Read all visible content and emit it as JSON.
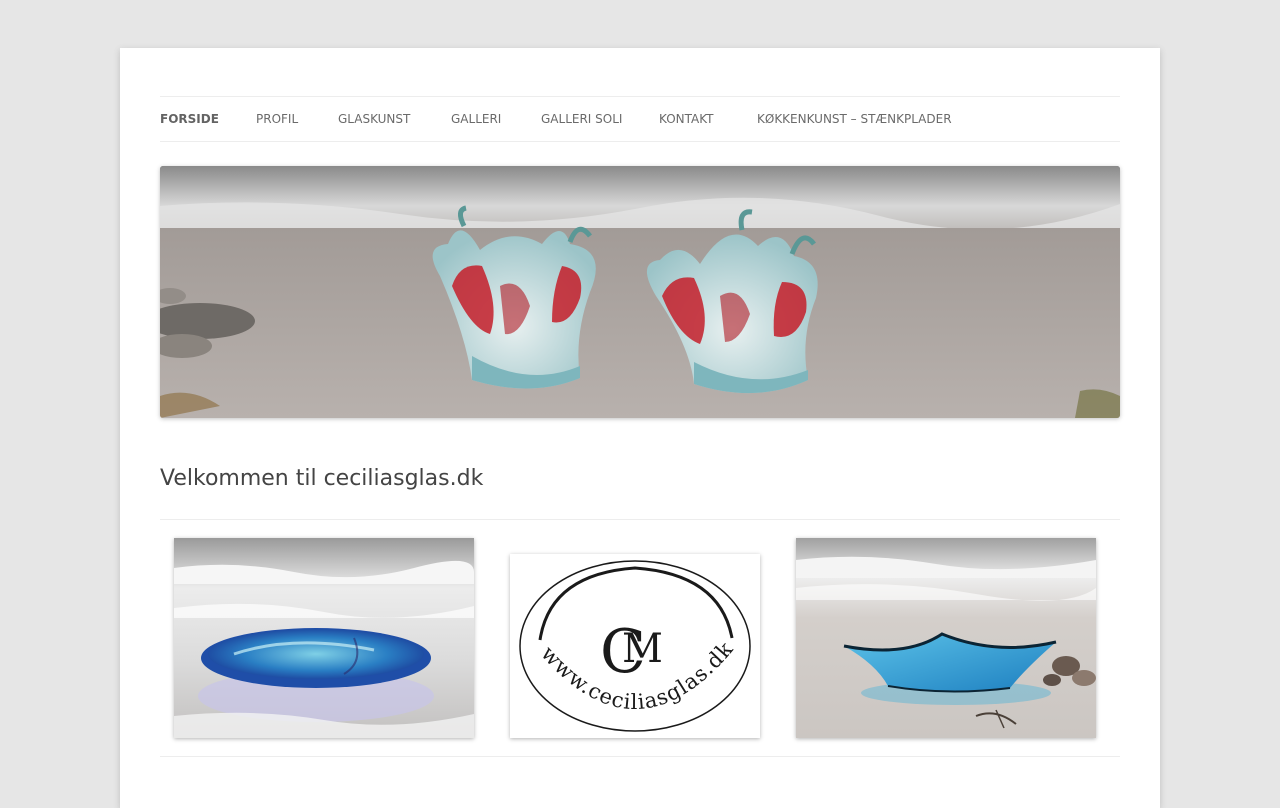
{
  "nav": {
    "items": [
      {
        "label": "FORSIDE",
        "current": true
      },
      {
        "label": "PROFIL"
      },
      {
        "label": "GLASKUNST"
      },
      {
        "label": "GALLERI"
      },
      {
        "label": "GALLERI SOLI"
      },
      {
        "label": "KONTAKT"
      },
      {
        "label": "KØKKENKUNST – STÆNKPLADER"
      }
    ]
  },
  "content": {
    "title": "Velkommen til ceciliasglas.dk"
  },
  "gallery": {
    "logo": {
      "initials_c": "C",
      "initials_m": "M",
      "url_text": "www.ceciliasglas.dk"
    }
  },
  "colors": {
    "background": "#e6e6e6",
    "page": "#ffffff",
    "nav_text": "#6a6a6a",
    "title_text": "#444444",
    "glass_red": "#c41e2a",
    "glass_turquoise": "#39a9c9"
  }
}
